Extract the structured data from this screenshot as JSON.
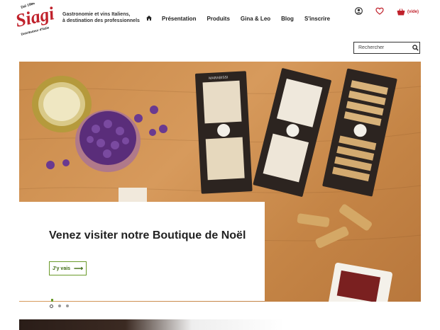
{
  "brand": {
    "logo_text": "Siagi",
    "logo_year": "Dal 1986",
    "logo_sub": "Distributeur d'Italie",
    "tagline_line1": "Gastronomie et vins Italiens,",
    "tagline_line2": "à destination des professionnels",
    "color": "#c0212b"
  },
  "nav": {
    "home_icon": "home-icon",
    "items": [
      {
        "label": "Présentation"
      },
      {
        "label": "Produits"
      },
      {
        "label": "Gina & Leo"
      },
      {
        "label": "Blog"
      },
      {
        "label": "S'inscrire"
      }
    ]
  },
  "header_icons": {
    "account": "user-icon",
    "wishlist": "heart-icon",
    "cart_icon": "basket-icon",
    "cart_label": "(vide)"
  },
  "search": {
    "placeholder": "Rechercher",
    "icon": "search-icon"
  },
  "hero": {
    "headline": "Venez visiter notre Boutique de Noël",
    "cta_label": "J'y vais",
    "cta_icon": "arrow-right-icon",
    "box_brand": "MARABISSI",
    "accent": "#6a9a2a",
    "slides": 3,
    "active_slide": 1
  }
}
